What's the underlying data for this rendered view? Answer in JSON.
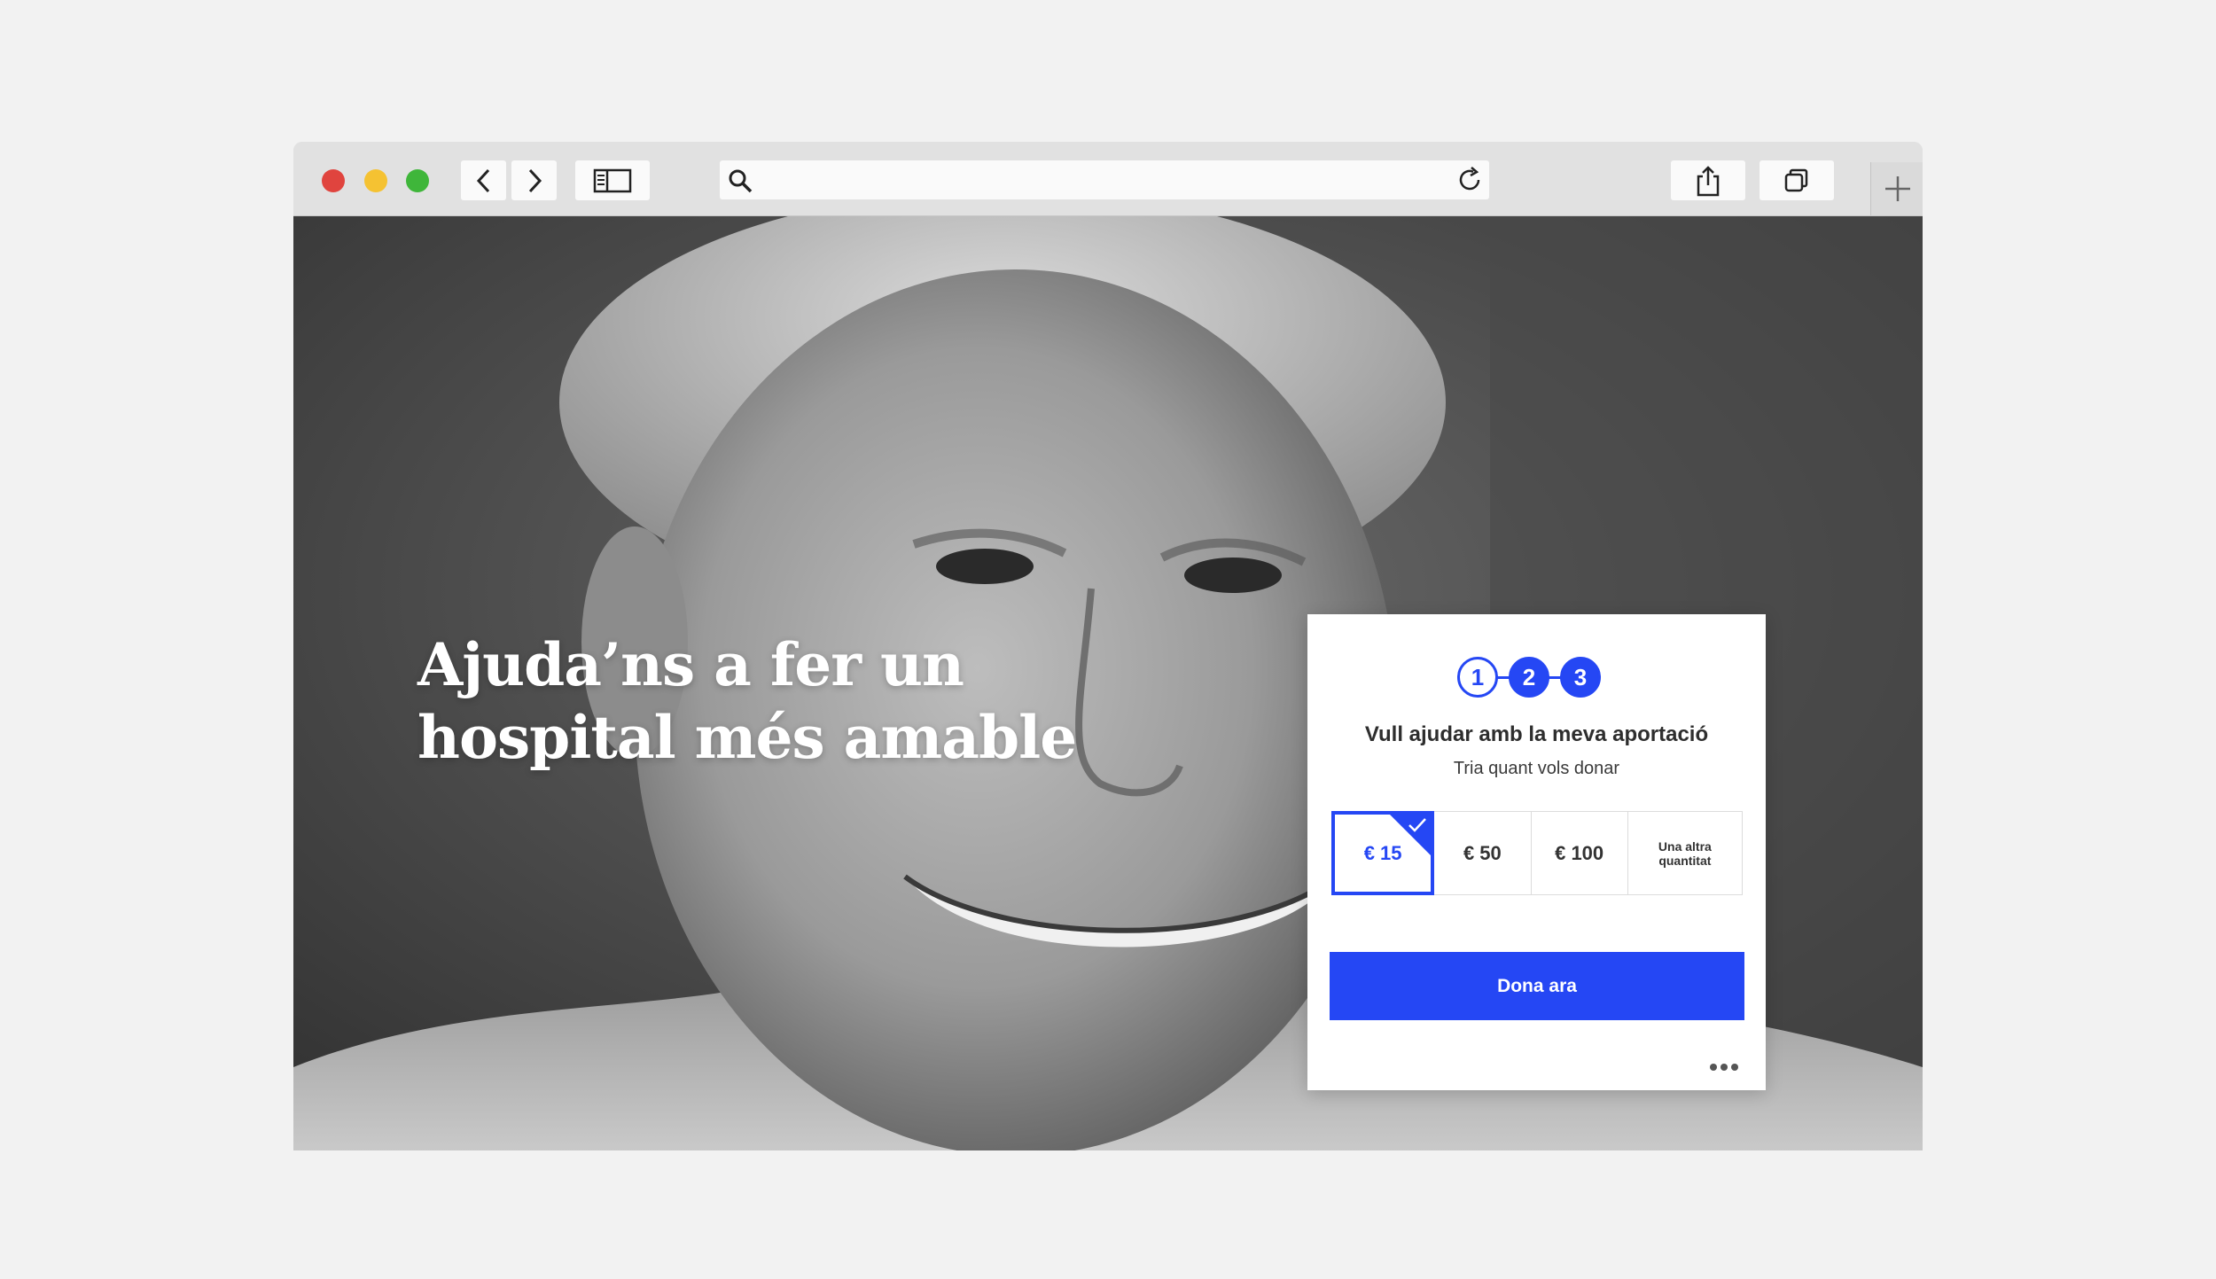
{
  "browser": {
    "traffic_lights": {
      "close_color": "#e0443e",
      "minimize_color": "#f5c232",
      "zoom_color": "#3fb63a"
    },
    "url_bar": {
      "value": "",
      "placeholder": ""
    }
  },
  "hero": {
    "title_line1": "Ajuda’ns a fer un",
    "title_line2": "hospital més amable",
    "image_description_icon": "portrait-photo"
  },
  "donation_card": {
    "steps": [
      "1",
      "2",
      "3"
    ],
    "title": "Vull ajudar amb la meva aportació",
    "subtitle": "Tria quant vols donar",
    "amounts": [
      {
        "label": "€ 15",
        "selected": true
      },
      {
        "label": "€ 50",
        "selected": false
      },
      {
        "label": "€ 100",
        "selected": false
      },
      {
        "label": "Una altra quantitat",
        "selected": false
      }
    ],
    "donate_label": "Dona ara",
    "accent_color": "#2547f4"
  }
}
